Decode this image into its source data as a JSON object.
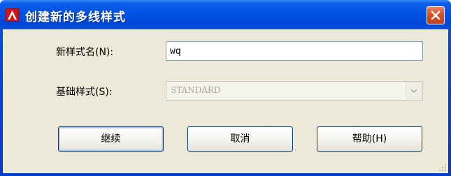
{
  "window": {
    "title": "创建新的多线样式",
    "icon": "autocad-icon"
  },
  "form": {
    "name_label": "新样式名(N):",
    "name_value": "wq",
    "base_label": "基础样式(S):",
    "base_value": "STANDARD"
  },
  "buttons": {
    "continue_label": "继续",
    "cancel_label": "取消",
    "help_label": "帮助(H)"
  },
  "colors": {
    "titlebar": "#0052e3",
    "client_bg": "#ece9d8",
    "close_button": "#d9532c"
  }
}
